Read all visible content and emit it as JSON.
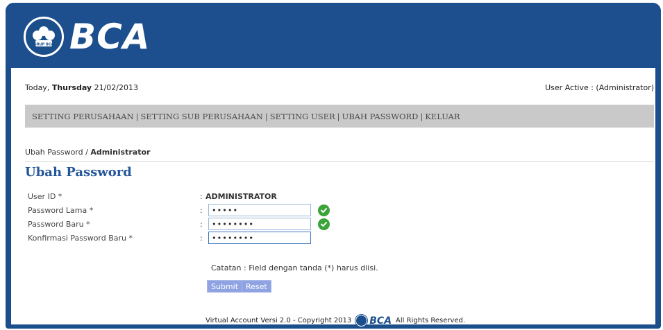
{
  "brand": {
    "logo_text": "BCA",
    "emblem_text": "GRUP BCA",
    "color": "#1d4f8e"
  },
  "topbar": {
    "date_prefix": "Today,",
    "day": "Thursday",
    "date": "21/02/2013",
    "user_active": "User Active : (Administrator)"
  },
  "menu": {
    "items": [
      "SETTING PERUSAHAAN",
      "SETTING SUB PERUSAHAAN",
      "SETTING USER",
      "UBAH PASSWORD",
      "KELUAR"
    ],
    "separator": "|"
  },
  "breadcrumb": {
    "parent": "Ubah Password /",
    "current": "Administrator"
  },
  "page_title": "Ubah Password",
  "form": {
    "user_id_label": "User ID *",
    "user_id_value": "ADMINISTRATOR",
    "old_password_label": "Password Lama *",
    "old_password_value": "•••••",
    "new_password_label": "Password Baru *",
    "new_password_value": "••••••••",
    "confirm_password_label": "Konfirmasi Password Baru *",
    "confirm_password_value": "••••••••",
    "colon": ":",
    "note": "Catatan : Field dengan tanda (*) harus diisi.",
    "submit_label": "Submit",
    "reset_label": "Reset"
  },
  "footer": {
    "left_text": "Virtual Account Versi 2.0 - Copyright 2013",
    "logo_text": "BCA",
    "right_text": "All Rights Reserved."
  },
  "icons": {
    "valid": "check-circle-icon",
    "valid_color": "#3aa33a"
  }
}
